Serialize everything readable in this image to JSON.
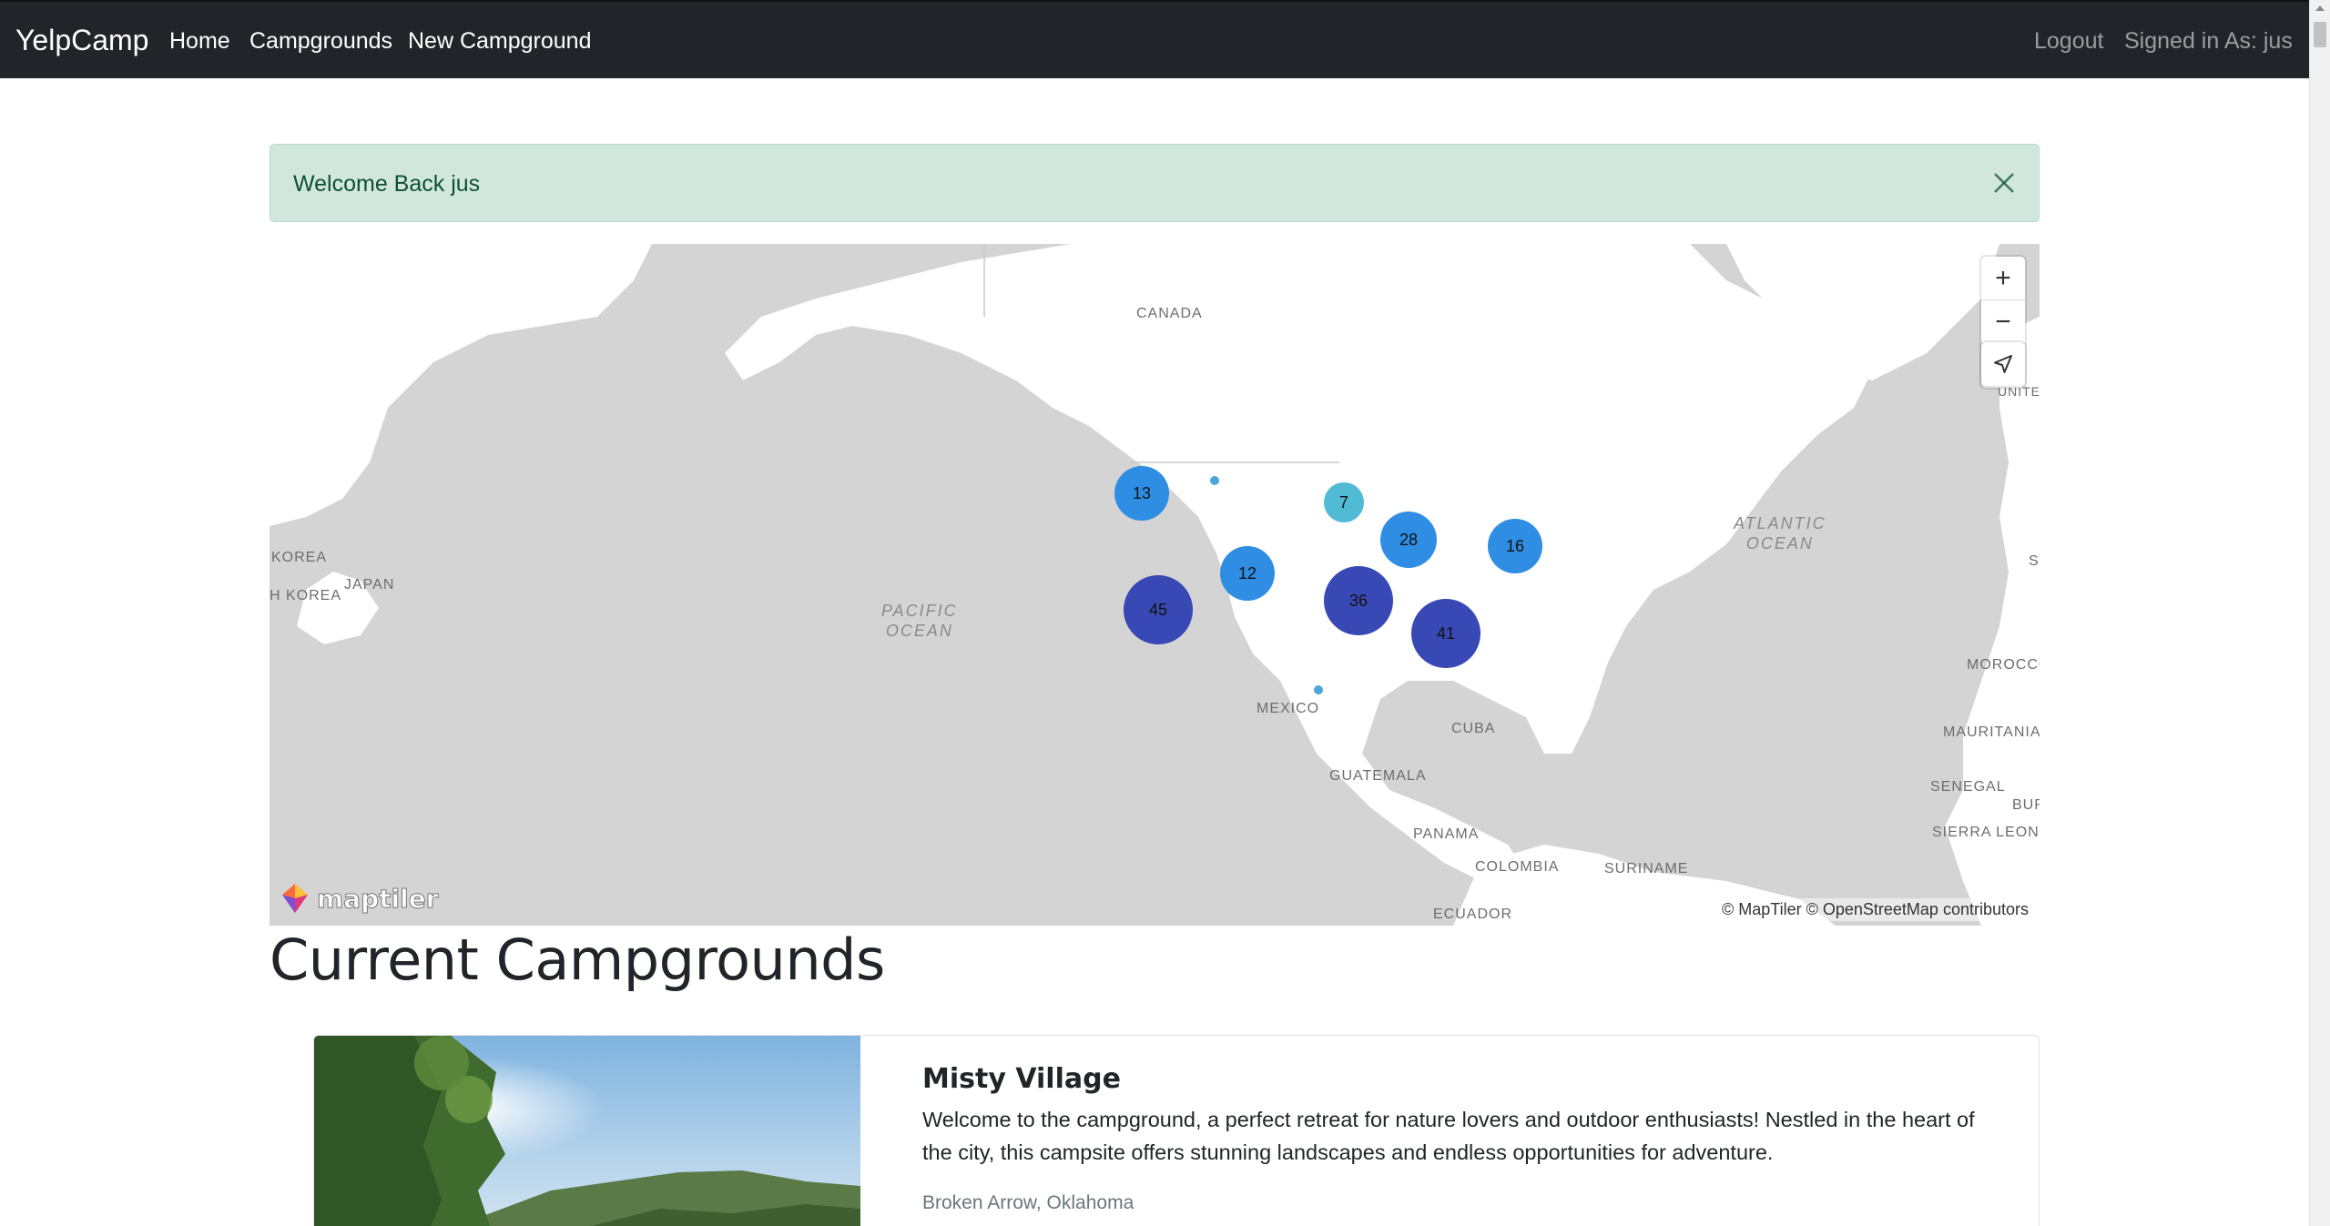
{
  "navbar": {
    "brand": "YelpCamp",
    "links": [
      "Home",
      "Campgrounds",
      "New Campground"
    ],
    "logout": "Logout",
    "signed_in": "Signed in As: jus"
  },
  "alert": {
    "message": "Welcome Back jus",
    "close_icon": "close-icon"
  },
  "map": {
    "labels": {
      "canada": "CANADA",
      "korea": "KOREA",
      "south_korea": "H KOREA",
      "japan": "JAPAN",
      "pacific": "PACIFIC\nOCEAN",
      "atlantic": "ATLANTIC\nOCEAN",
      "mexico": "MEXICO",
      "cuba": "CUBA",
      "guatemala": "GUATEMALA",
      "panama": "PANAMA",
      "colombia": "COLOMBIA",
      "suriname": "SURINAME",
      "ecuador": "ECUADOR",
      "morocco": "MOROCCO",
      "mauritania": "MAURITANIA",
      "senegal": "SENEGAL",
      "sierra_leone": "SIERRA LEONE",
      "bur": "BUR",
      "unite": "UNITE",
      "s_edge": "S"
    },
    "clusters": [
      "13",
      "7",
      "28",
      "16",
      "12",
      "45",
      "36",
      "41"
    ],
    "cluster_colors": {
      "small": "#51bbd6",
      "medium": "#2f8de4",
      "large": "#3848b5"
    },
    "controls": {
      "zoom_in": "+",
      "zoom_out": "−",
      "compass_icon": "compass-icon",
      "geolocate_icon": "geolocate-icon"
    },
    "logo_text": "maptiler",
    "attribution": "© MapTiler © OpenStreetMap contributors"
  },
  "page_title": "Current Campgrounds",
  "campgrounds": [
    {
      "title": "Misty Village",
      "description": "Welcome to the campground, a perfect retreat for nature lovers and outdoor enthusiasts! Nestled in the heart of the city, this campsite offers stunning landscapes and endless opportunities for adventure.",
      "location": "Broken Arrow, Oklahoma"
    }
  ]
}
